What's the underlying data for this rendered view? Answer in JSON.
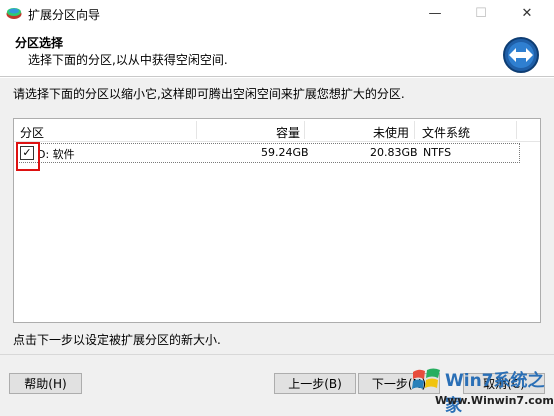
{
  "window": {
    "title": "扩展分区向导",
    "minimize": "—",
    "maximize": "☐",
    "close": "✕"
  },
  "header": {
    "title": "分区选择",
    "subtitle": "选择下面的分区,以从中获得空闲空间."
  },
  "instruction": "请选择下面的分区以缩小它,这样即可腾出空闲空间来扩展您想扩大的分区.",
  "table": {
    "columns": [
      "分区",
      "容量",
      "未使用",
      "文件系统"
    ],
    "rows": [
      {
        "checked": true,
        "check_mark": "✓",
        "partition": "D: 软件",
        "capacity": "59.24GB",
        "unused": "20.83GB",
        "filesystem": "NTFS"
      }
    ]
  },
  "footer_text": "点击下一步以设定被扩展分区的新大小.",
  "buttons": {
    "help": "帮助(H)",
    "back": "上一步(B)",
    "next": "下一步(N)",
    "cancel": "取消(C)"
  },
  "watermark": {
    "main": "Win7系统之家",
    "url": "Www.Winwin7.com"
  },
  "colors": {
    "highlight": "#dd1111",
    "brand": "#2a6fb6"
  }
}
